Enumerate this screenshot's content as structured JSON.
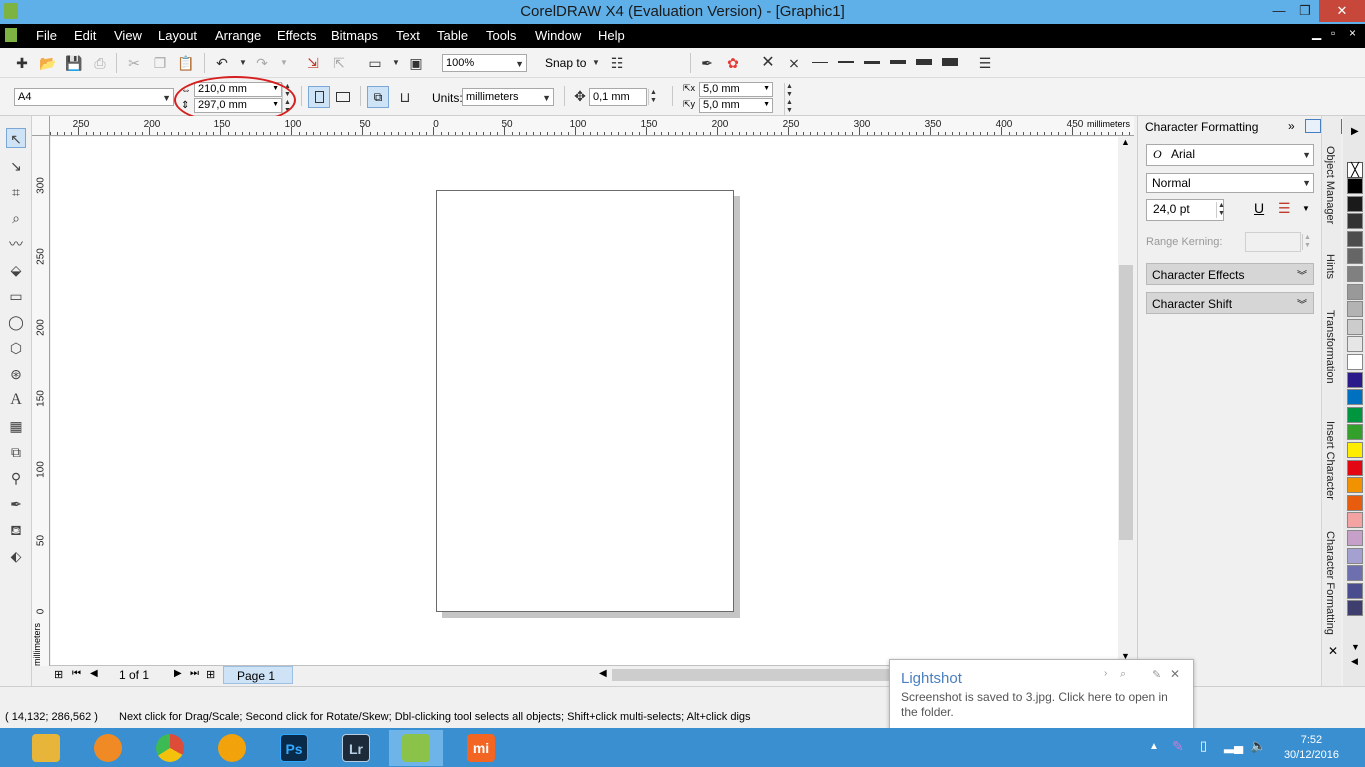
{
  "window": {
    "title": "CorelDRAW X4 (Evaluation Version) - [Graphic1]",
    "minimize": "—",
    "restore": "❐",
    "close": "✕"
  },
  "menu": {
    "items": [
      {
        "label": "File"
      },
      {
        "label": "Edit"
      },
      {
        "label": "View"
      },
      {
        "label": "Layout"
      },
      {
        "label": "Arrange"
      },
      {
        "label": "Effects"
      },
      {
        "label": "Bitmaps"
      },
      {
        "label": "Text"
      },
      {
        "label": "Table"
      },
      {
        "label": "Tools"
      },
      {
        "label": "Window"
      },
      {
        "label": "Help"
      }
    ]
  },
  "standard_toolbar": {
    "zoom_level": "100%",
    "snap_to": "Snap to"
  },
  "property_bar": {
    "paper_type": "A4",
    "page_width": "210,0 mm",
    "page_height": "297,0 mm",
    "units_label": "Units:",
    "units_value": "millimeters",
    "nudge": "0,1 mm",
    "duplicate_x": "5,0 mm",
    "duplicate_y": "5,0 mm"
  },
  "ruler": {
    "horizontal_labels": [
      "250",
      "200",
      "150",
      "100",
      "50",
      "0",
      "50",
      "100",
      "150",
      "200",
      "250",
      "300",
      "350",
      "400",
      "450"
    ],
    "units": "millimeters",
    "vertical_labels": [
      "300",
      "250",
      "200",
      "150",
      "100",
      "50",
      "0"
    ],
    "vertical_units": "millimeters"
  },
  "page_nav": {
    "page_count": "1 of 1",
    "page_tab": "Page 1"
  },
  "status": {
    "coordinates": "( 14,132; 286,562 )",
    "message": "Next click for Drag/Scale; Second click for Rotate/Skew; Dbl-clicking tool selects all objects; Shift+click multi-selects; Alt+click digs"
  },
  "docker": {
    "title": "Character Formatting",
    "font": "Arial",
    "style": "Normal",
    "size": "24,0 pt",
    "range_kerning_label": "Range Kerning:",
    "sections": [
      "Character Effects",
      "Character Shift"
    ]
  },
  "docker_tabs": [
    "Object Manager",
    "Hints",
    "Transformation",
    "Insert Character",
    "Character Formatting"
  ],
  "palette": {
    "colors": [
      "#000000",
      "#1a1a1a",
      "#333333",
      "#4d4d4d",
      "#666666",
      "#808080",
      "#999999",
      "#b3b3b3",
      "#cccccc",
      "#e6e6e6",
      "#ffffff",
      "#2b1b8a",
      "#0070c0",
      "#009640",
      "#33a02c",
      "#ffed00",
      "#e30613",
      "#f39200",
      "#e85d0d",
      "#f4a3a3",
      "#c6a0c8",
      "#a4a0d0",
      "#6d6faf",
      "#4a4e8f",
      "#3e3e6e"
    ]
  },
  "lightshot": {
    "title": "Lightshot",
    "message": "Screenshot is saved to 3.jpg. Click here to open in the folder."
  },
  "taskbar": {
    "apps": [
      {
        "name": "file-explorer",
        "label": "",
        "color": "#e7b53a"
      },
      {
        "name": "uc-browser",
        "label": "",
        "color": "#f08a24"
      },
      {
        "name": "chrome",
        "label": "",
        "color": "#dd4b39"
      },
      {
        "name": "media-player",
        "label": "",
        "color": "#f2a20a"
      },
      {
        "name": "photoshop",
        "label": "Ps",
        "color": "#0a2a4a"
      },
      {
        "name": "lightroom",
        "label": "Lr",
        "color": "#1c2a3a"
      },
      {
        "name": "coreldraw",
        "label": "",
        "color": "#8bc34a"
      },
      {
        "name": "mi",
        "label": "mi",
        "color": "#f26522"
      }
    ],
    "time": "7:52",
    "date": "30/12/2016"
  }
}
